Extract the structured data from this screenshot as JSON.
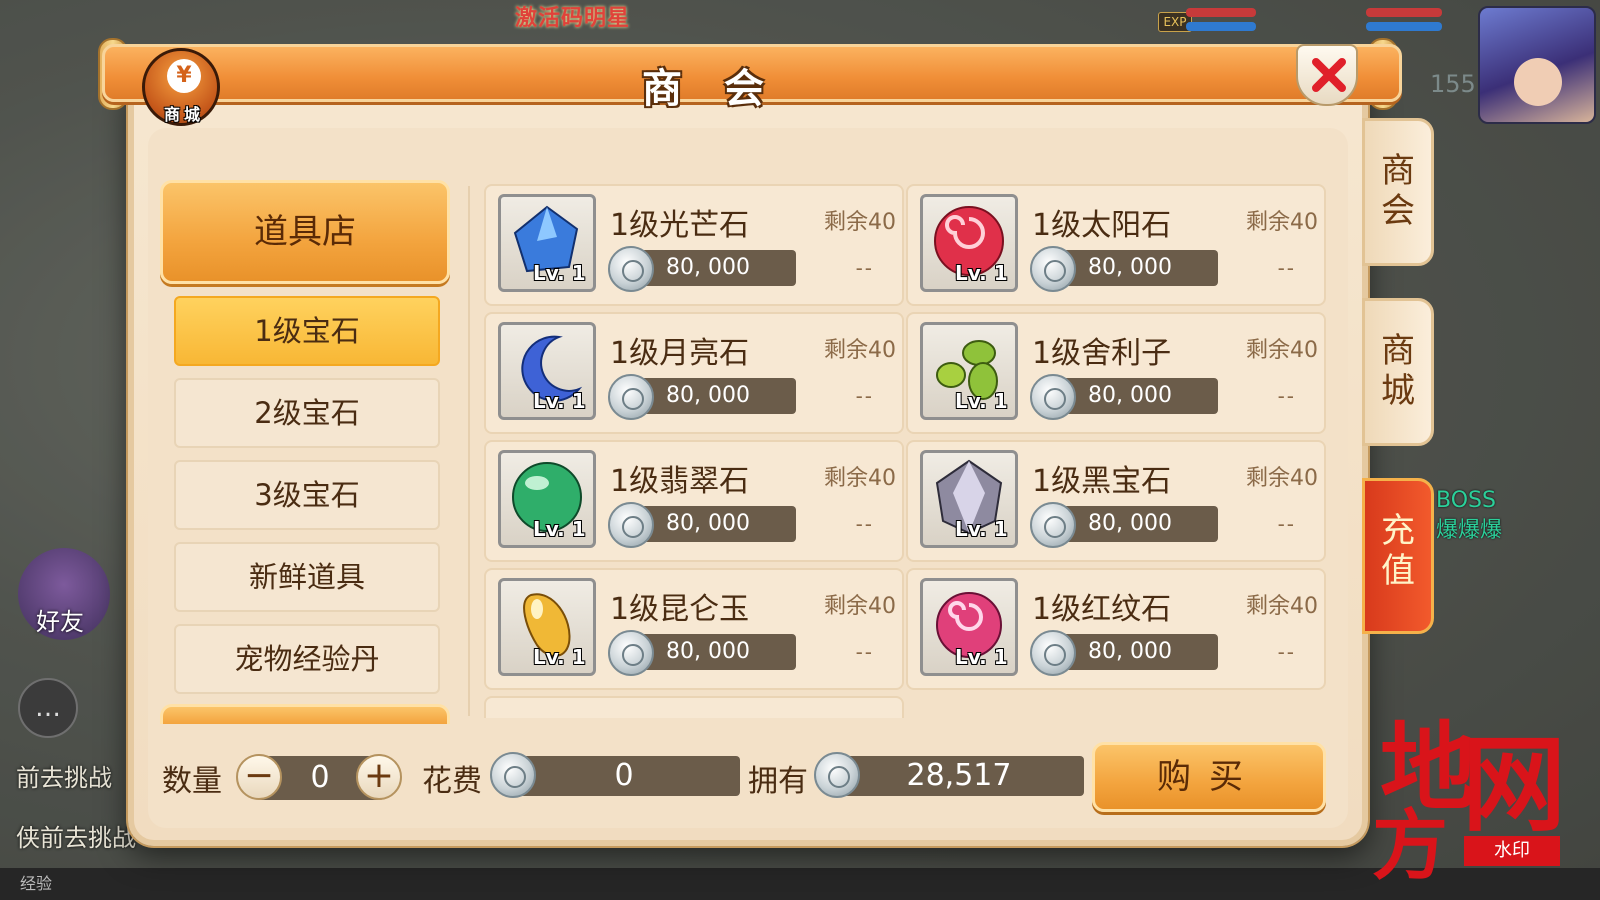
{
  "background": {
    "banner_text": "激活码明星",
    "exp_label": "EXP",
    "level_number": "155",
    "left_texts": [
      "前去挑战",
      "侠前去挑战"
    ],
    "friend_label": "好友",
    "boss_text_lines": [
      "BOSS",
      "爆爆爆"
    ],
    "bottom_exp_label": "经验",
    "watermark": {
      "char1": "地",
      "char2": "方",
      "char3": "网",
      "seal": "水印"
    }
  },
  "dialog": {
    "title": "商 会",
    "shop_badge": {
      "glyph": "¥",
      "label": "商城"
    },
    "close_icon": "close-x-icon"
  },
  "sidebar": {
    "header": "道具店",
    "items": [
      {
        "label": "1级宝石",
        "active": true
      },
      {
        "label": "2级宝石",
        "active": false
      },
      {
        "label": "3级宝石",
        "active": false
      },
      {
        "label": "新鲜道具",
        "active": false
      },
      {
        "label": "宠物经验丹",
        "active": false
      }
    ]
  },
  "items": [
    {
      "name": "1级光芒石",
      "stock": "剩余40",
      "price": "80, 000",
      "level": "Lv. 1",
      "dash": "--",
      "icon": "blue-crystal-icon",
      "color": "#3a7bdc"
    },
    {
      "name": "1级太阳石",
      "stock": "剩余40",
      "price": "80, 000",
      "level": "Lv. 1",
      "dash": "--",
      "icon": "red-swirl-orb-icon",
      "color": "#e0304a"
    },
    {
      "name": "1级月亮石",
      "stock": "剩余40",
      "price": "80, 000",
      "level": "Lv. 1",
      "dash": "--",
      "icon": "blue-moon-icon",
      "color": "#3e62d6"
    },
    {
      "name": "1级舍利子",
      "stock": "剩余40",
      "price": "80, 000",
      "level": "Lv. 1",
      "dash": "--",
      "icon": "green-beads-icon",
      "color": "#8fc23a"
    },
    {
      "name": "1级翡翠石",
      "stock": "剩余40",
      "price": "80, 000",
      "level": "Lv. 1",
      "dash": "--",
      "icon": "green-orb-icon",
      "color": "#2fae6a"
    },
    {
      "name": "1级黑宝石",
      "stock": "剩余40",
      "price": "80, 000",
      "level": "Lv. 1",
      "dash": "--",
      "icon": "black-diamond-icon",
      "color": "#8e8aa0"
    },
    {
      "name": "1级昆仑玉",
      "stock": "剩余40",
      "price": "80, 000",
      "level": "Lv. 1",
      "dash": "--",
      "icon": "yellow-jade-icon",
      "color": "#f0b836"
    },
    {
      "name": "1级红纹石",
      "stock": "剩余40",
      "price": "80, 000",
      "level": "Lv. 1",
      "dash": "--",
      "icon": "pink-swirl-orb-icon",
      "color": "#e0407a"
    }
  ],
  "side_tabs": [
    {
      "label": "商会",
      "icon": "shop-tab"
    },
    {
      "label": "商城",
      "icon": "mall-tab"
    },
    {
      "label": "充值",
      "icon": "recharge-tab"
    }
  ],
  "footer": {
    "quantity_label": "数量",
    "quantity_value": "0",
    "minus": "−",
    "plus": "+",
    "cost_label": "花费",
    "cost_value": "0",
    "own_label": "拥有",
    "own_value": "28,517",
    "buy_label": "购买"
  },
  "colors": {
    "accent_orange": "#f3a43e",
    "panel_bg": "#f3e1c8",
    "price_bar": "#6b5c4a",
    "close_red": "#e0202a"
  }
}
